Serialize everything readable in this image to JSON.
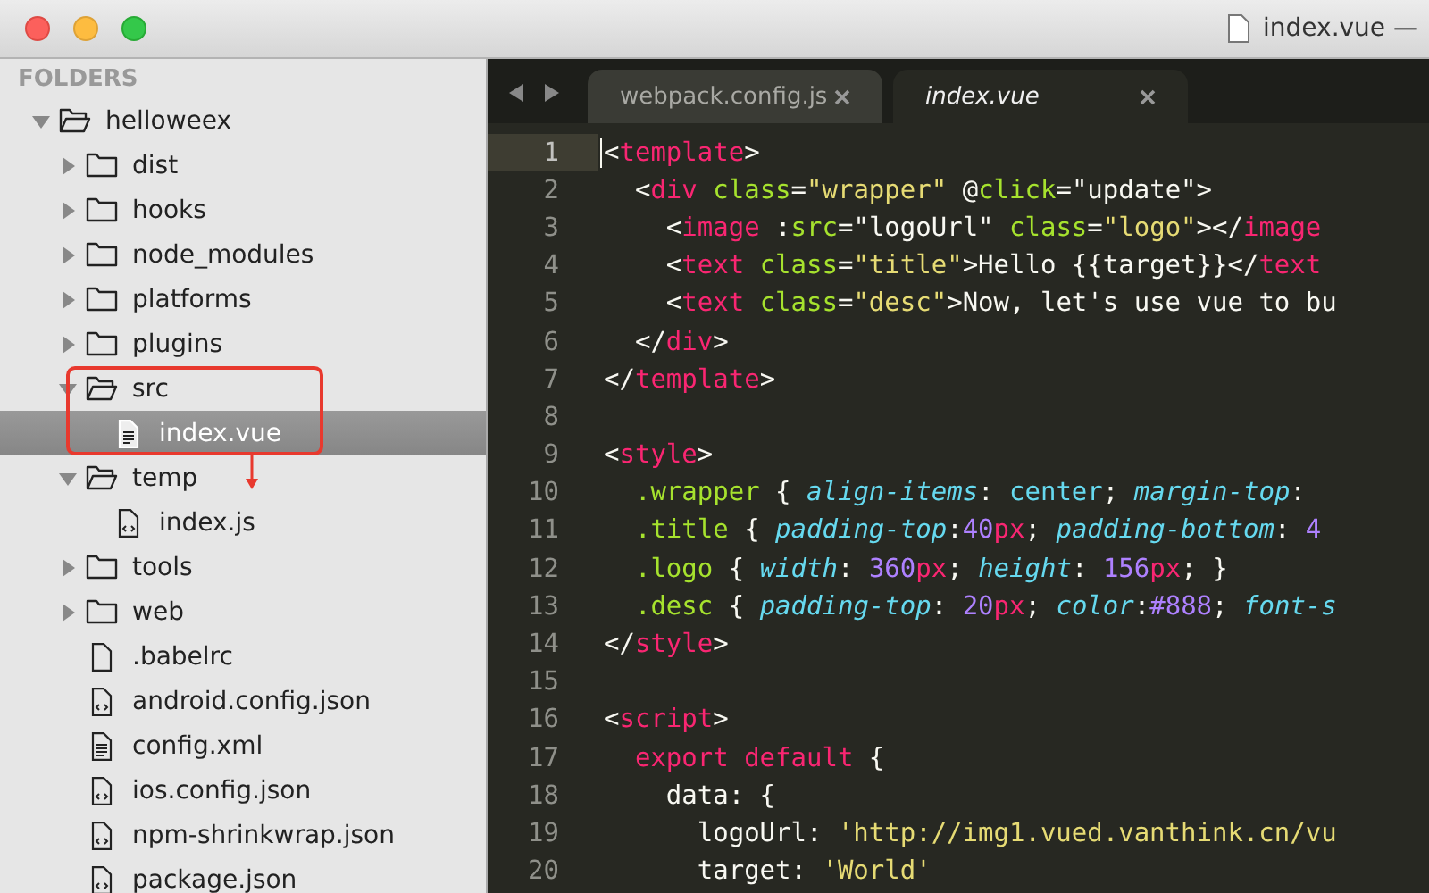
{
  "window": {
    "title": "index.vue —"
  },
  "sidebar": {
    "heading": "FOLDERS",
    "tree": [
      {
        "name": "helloweex",
        "kind": "folder",
        "expanded": true,
        "selected": false,
        "children": [
          {
            "name": "dist",
            "kind": "folder",
            "expanded": false,
            "selected": false
          },
          {
            "name": "hooks",
            "kind": "folder",
            "expanded": false,
            "selected": false
          },
          {
            "name": "node_modules",
            "kind": "folder",
            "expanded": false,
            "selected": false
          },
          {
            "name": "platforms",
            "kind": "folder",
            "expanded": false,
            "selected": false
          },
          {
            "name": "plugins",
            "kind": "folder",
            "expanded": false,
            "selected": false
          },
          {
            "name": "src",
            "kind": "folder",
            "expanded": true,
            "selected": false,
            "children": [
              {
                "name": "index.vue",
                "kind": "text-file",
                "selected": true
              }
            ]
          },
          {
            "name": "temp",
            "kind": "folder",
            "expanded": true,
            "selected": false,
            "children": [
              {
                "name": "index.js",
                "kind": "code-file",
                "selected": false
              }
            ]
          },
          {
            "name": "tools",
            "kind": "folder",
            "expanded": false,
            "selected": false
          },
          {
            "name": "web",
            "kind": "folder",
            "expanded": false,
            "selected": false
          },
          {
            "name": ".babelrc",
            "kind": "file",
            "selected": false
          },
          {
            "name": "android.config.json",
            "kind": "code-file",
            "selected": false
          },
          {
            "name": "config.xml",
            "kind": "text-file",
            "selected": false
          },
          {
            "name": "ios.config.json",
            "kind": "code-file",
            "selected": false
          },
          {
            "name": "npm-shrinkwrap.json",
            "kind": "code-file",
            "selected": false
          },
          {
            "name": "package.json",
            "kind": "code-file",
            "selected": false
          }
        ]
      }
    ]
  },
  "tabs": [
    {
      "label": "webpack.config.js",
      "selected": false
    },
    {
      "label": "index.vue",
      "selected": true
    }
  ],
  "editor": {
    "lines": [
      {
        "number": "1",
        "current": true,
        "tokens": [
          {
            "kind": "p",
            "text": "<"
          },
          {
            "kind": "t",
            "text": "template"
          },
          {
            "kind": "p",
            "text": ">"
          }
        ]
      },
      {
        "number": "2",
        "current": false,
        "tokens": [
          {
            "kind": "p",
            "text": "  <"
          },
          {
            "kind": "t",
            "text": "div "
          },
          {
            "kind": "a",
            "text": "class"
          },
          {
            "kind": "p",
            "text": "="
          },
          {
            "kind": "s",
            "text": "\"wrapper\""
          },
          {
            "kind": "p",
            "text": " @"
          },
          {
            "kind": "a",
            "text": "click"
          },
          {
            "kind": "p",
            "text": "=\"update\">"
          }
        ]
      },
      {
        "number": "3",
        "current": false,
        "tokens": [
          {
            "kind": "p",
            "text": "    <"
          },
          {
            "kind": "t",
            "text": "image"
          },
          {
            "kind": "p",
            "text": " :"
          },
          {
            "kind": "a",
            "text": "src"
          },
          {
            "kind": "p",
            "text": "=\"logoUrl\" "
          },
          {
            "kind": "a",
            "text": "class"
          },
          {
            "kind": "p",
            "text": "="
          },
          {
            "kind": "s",
            "text": "\"logo\""
          },
          {
            "kind": "p",
            "text": "></"
          },
          {
            "kind": "t",
            "text": "image"
          }
        ]
      },
      {
        "number": "4",
        "current": false,
        "tokens": [
          {
            "kind": "p",
            "text": "    <"
          },
          {
            "kind": "t",
            "text": "text "
          },
          {
            "kind": "a",
            "text": "class"
          },
          {
            "kind": "p",
            "text": "="
          },
          {
            "kind": "s",
            "text": "\"title\""
          },
          {
            "kind": "p",
            "text": ">Hello {{target}}</"
          },
          {
            "kind": "t",
            "text": "text"
          }
        ]
      },
      {
        "number": "5",
        "current": false,
        "tokens": [
          {
            "kind": "p",
            "text": "    <"
          },
          {
            "kind": "t",
            "text": "text "
          },
          {
            "kind": "a",
            "text": "class"
          },
          {
            "kind": "p",
            "text": "="
          },
          {
            "kind": "s",
            "text": "\"desc\""
          },
          {
            "kind": "p",
            "text": ">Now, let's use vue to bu"
          }
        ]
      },
      {
        "number": "6",
        "current": false,
        "tokens": [
          {
            "kind": "p",
            "text": "  </"
          },
          {
            "kind": "t",
            "text": "div"
          },
          {
            "kind": "p",
            "text": ">"
          }
        ]
      },
      {
        "number": "7",
        "current": false,
        "tokens": [
          {
            "kind": "p",
            "text": "</"
          },
          {
            "kind": "t",
            "text": "template"
          },
          {
            "kind": "p",
            "text": ">"
          }
        ]
      },
      {
        "number": "8",
        "current": false
      },
      {
        "number": "9",
        "current": false,
        "tokens": [
          {
            "kind": "p",
            "text": "<"
          },
          {
            "kind": "t",
            "text": "style"
          },
          {
            "kind": "p",
            "text": ">"
          }
        ]
      },
      {
        "number": "10",
        "current": false,
        "tokens": [
          {
            "kind": "a",
            "text": "  .wrapper"
          },
          {
            "kind": "p",
            "text": " { "
          },
          {
            "kind": "c",
            "text": "align-items"
          },
          {
            "kind": "p",
            "text": ": "
          },
          {
            "kind": "v",
            "text": "center"
          },
          {
            "kind": "p",
            "text": "; "
          },
          {
            "kind": "c",
            "text": "margin-top"
          },
          {
            "kind": "p",
            "text": ":"
          }
        ]
      },
      {
        "number": "11",
        "current": false,
        "tokens": [
          {
            "kind": "a",
            "text": "  .title"
          },
          {
            "kind": "p",
            "text": " { "
          },
          {
            "kind": "c",
            "text": "padding-top"
          },
          {
            "kind": "p",
            "text": ":"
          },
          {
            "kind": "n",
            "text": "40"
          },
          {
            "kind": "t",
            "text": "px"
          },
          {
            "kind": "p",
            "text": "; "
          },
          {
            "kind": "c",
            "text": "padding-bottom"
          },
          {
            "kind": "p",
            "text": ": "
          },
          {
            "kind": "n",
            "text": "4"
          }
        ]
      },
      {
        "number": "12",
        "current": false,
        "tokens": [
          {
            "kind": "a",
            "text": "  .logo"
          },
          {
            "kind": "p",
            "text": " { "
          },
          {
            "kind": "c",
            "text": "width"
          },
          {
            "kind": "p",
            "text": ": "
          },
          {
            "kind": "n",
            "text": "360"
          },
          {
            "kind": "t",
            "text": "px"
          },
          {
            "kind": "p",
            "text": "; "
          },
          {
            "kind": "c",
            "text": "height"
          },
          {
            "kind": "p",
            "text": ": "
          },
          {
            "kind": "n",
            "text": "156"
          },
          {
            "kind": "t",
            "text": "px"
          },
          {
            "kind": "p",
            "text": "; }"
          }
        ]
      },
      {
        "number": "13",
        "current": false,
        "tokens": [
          {
            "kind": "a",
            "text": "  .desc"
          },
          {
            "kind": "p",
            "text": " { "
          },
          {
            "kind": "c",
            "text": "padding-top"
          },
          {
            "kind": "p",
            "text": ": "
          },
          {
            "kind": "n",
            "text": "20"
          },
          {
            "kind": "t",
            "text": "px"
          },
          {
            "kind": "p",
            "text": "; "
          },
          {
            "kind": "c",
            "text": "color"
          },
          {
            "kind": "p",
            "text": ":"
          },
          {
            "kind": "n",
            "text": "#888"
          },
          {
            "kind": "p",
            "text": "; "
          },
          {
            "kind": "c",
            "text": "font-s"
          }
        ]
      },
      {
        "number": "14",
        "current": false,
        "tokens": [
          {
            "kind": "p",
            "text": "</"
          },
          {
            "kind": "t",
            "text": "style"
          },
          {
            "kind": "p",
            "text": ">"
          }
        ]
      },
      {
        "number": "15",
        "current": false
      },
      {
        "number": "16",
        "current": false,
        "tokens": [
          {
            "kind": "p",
            "text": "<"
          },
          {
            "kind": "t",
            "text": "script"
          },
          {
            "kind": "p",
            "text": ">"
          }
        ]
      },
      {
        "number": "17",
        "current": false,
        "tokens": [
          {
            "kind": "t",
            "text": "  export "
          },
          {
            "kind": "t",
            "text": "default"
          },
          {
            "kind": "p",
            "text": " {"
          }
        ]
      },
      {
        "number": "18",
        "current": false,
        "tokens": [
          {
            "kind": "p",
            "text": "    data: {"
          }
        ]
      },
      {
        "number": "19",
        "current": false,
        "tokens": [
          {
            "kind": "p",
            "text": "      logoUrl: "
          },
          {
            "kind": "s",
            "text": "'http://img1.vued.vanthink.cn/vu"
          }
        ]
      },
      {
        "number": "20",
        "current": false,
        "tokens": [
          {
            "kind": "p",
            "text": "      target: "
          },
          {
            "kind": "s",
            "text": "'World'"
          }
        ]
      }
    ]
  }
}
